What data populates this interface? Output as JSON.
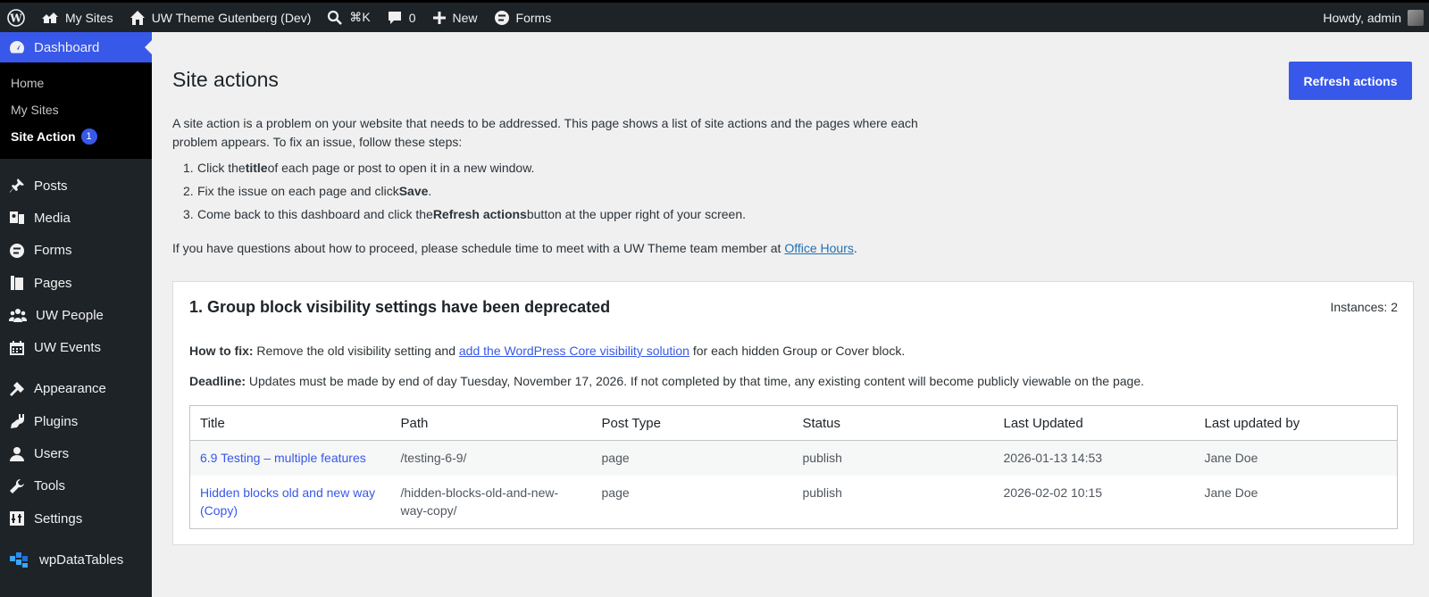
{
  "adminbar": {
    "my_sites": "My Sites",
    "site_name": "UW Theme Gutenberg (Dev)",
    "search_shortcut": "⌘K",
    "comments_count": "0",
    "new_label": "New",
    "forms_label": "Forms",
    "howdy": "Howdy, admin"
  },
  "sidebar": {
    "dashboard": "Dashboard",
    "submenu": [
      "Home",
      "My Sites",
      "Site Action"
    ],
    "site_action_badge": "1",
    "items": [
      "Posts",
      "Media",
      "Forms",
      "Pages",
      "UW People",
      "UW Events",
      "Appearance",
      "Plugins",
      "Users",
      "Tools",
      "Settings",
      "wpDataTables"
    ]
  },
  "page": {
    "title": "Site actions",
    "refresh_button": "Refresh actions",
    "intro": "A site action is a problem on your website that needs to be addressed. This page shows a list of site actions and the pages where each problem appears. To fix an issue, follow these steps:",
    "steps": [
      {
        "num": "1.",
        "pre": "Click the ",
        "bold": "title",
        "post": " of each page or post to open it in a new window."
      },
      {
        "num": "2.",
        "pre": "Fix the issue on each page and click ",
        "bold": "Save",
        "post": "."
      },
      {
        "num": "3.",
        "pre": "Come back to this dashboard and click the ",
        "bold": "Refresh actions",
        "post": " button at the upper right of your screen."
      }
    ],
    "help_pre": "If you have questions about how to proceed, please schedule time to meet with a UW Theme team member at ",
    "help_link": "Office Hours",
    "help_post": "."
  },
  "card": {
    "title": "1. Group block visibility settings have been deprecated",
    "instances": "Instances: 2",
    "howto_label": "How to fix:",
    "howto_pre": " Remove the old visibility setting and ",
    "howto_link": "add the WordPress Core visibility solution",
    "howto_post": " for each hidden Group or Cover block.",
    "deadline_label": "Deadline:",
    "deadline_text": " Updates must be made by end of day Tuesday, November 17, 2026. If not completed by that time, any existing content will become publicly viewable on the page.",
    "table": {
      "headers": [
        "Title",
        "Path",
        "Post Type",
        "Status",
        "Last Updated",
        "Last updated by"
      ],
      "rows": [
        {
          "title": "6.9 Testing – multiple features",
          "path": "/testing-6-9/",
          "type": "page",
          "status": "publish",
          "updated": "2026-01-13 14:53",
          "by": "Jane Doe"
        },
        {
          "title": "Hidden blocks old and new way (Copy)",
          "path": "/hidden-blocks-old-and-new-way-copy/",
          "type": "page",
          "status": "publish",
          "updated": "2026-02-02 10:15",
          "by": "Jane Doe"
        }
      ]
    }
  }
}
